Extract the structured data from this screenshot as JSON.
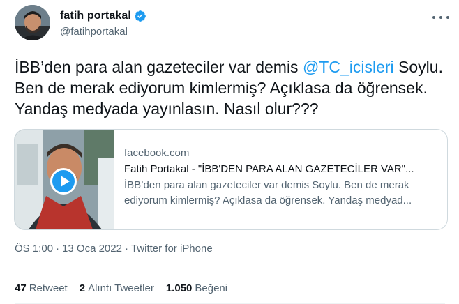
{
  "author": {
    "display_name": "fatih portakal",
    "handle": "@fatihportakal"
  },
  "tweet": {
    "text_before": "İBB’den para alan gazeteciler var demis ",
    "mention": "@TC_icisleri",
    "text_after": " Soylu. Ben de merak ediyorum kimlermiş? Açıklasa da öğrensek. Yandaş medyada yayınlasın. Nasıl olur???"
  },
  "card": {
    "domain": "facebook.com",
    "title": "Fatih Portakal - \"İBB'DEN PARA ALAN GAZETECİLER VAR\"...",
    "description": "İBB’den para alan gazeteciler var demis Soylu. Ben de merak ediyorum kimlermiş? Açıklasa da öğrensek. Yandaş medyad..."
  },
  "meta": {
    "time": "ÖS 1:00",
    "separator": "·",
    "date": "13 Oca 2022",
    "source": "Twitter for iPhone"
  },
  "stats": {
    "retweets_count": "47",
    "retweets_label": "Retweet",
    "quotes_count": "2",
    "quotes_label": "Alıntı Tweetler",
    "likes_count": "1.050",
    "likes_label": "Beğeni"
  },
  "colors": {
    "accent": "#1d9bf0",
    "text": "#0f1419",
    "secondary": "#536471",
    "border": "#cfd9de"
  },
  "icons": {
    "verified": "verified-badge-icon",
    "more": "more-options-icon",
    "play": "play-icon"
  }
}
